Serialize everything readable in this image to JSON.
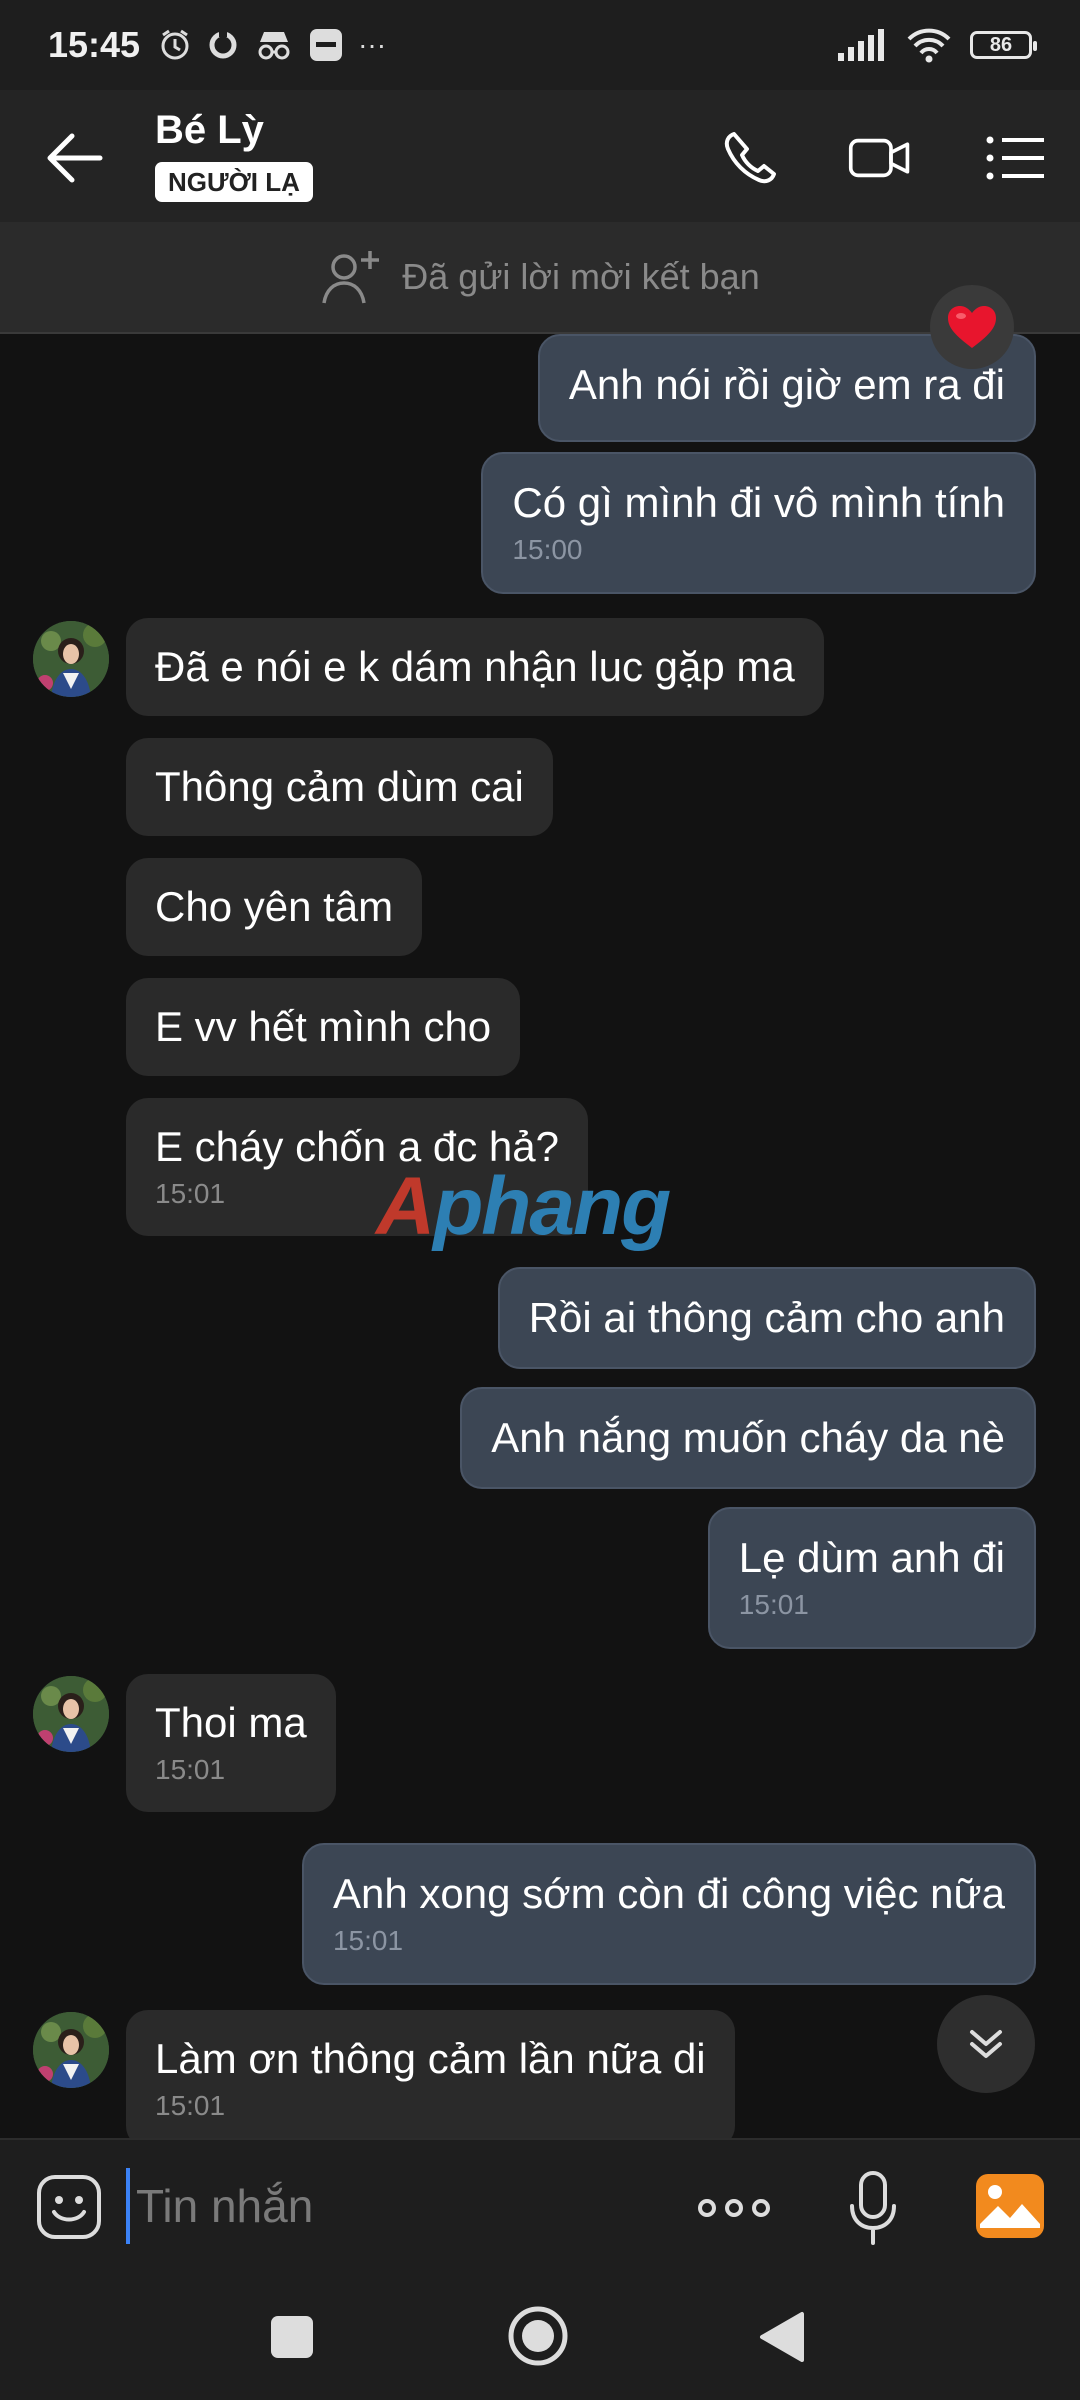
{
  "status_bar": {
    "time": "15:45",
    "battery": "86",
    "more": "···"
  },
  "header": {
    "contact_name": "Bé Lỳ",
    "badge": "NGƯỜI LẠ"
  },
  "friend_request": {
    "text": "Đã gửi lời mời kết bạn"
  },
  "messages": [
    {
      "dir": "out",
      "text": "Anh nói rồi giờ em ra đi",
      "time": ""
    },
    {
      "dir": "out",
      "text": "Có gì mình đi vô mình tính",
      "time": "15:00"
    },
    {
      "dir": "in",
      "text": "Đã e nói e k dám nhận luc gặp ma",
      "time": ""
    },
    {
      "dir": "in",
      "text": "Thông cảm dùm cai",
      "time": ""
    },
    {
      "dir": "in",
      "text": "Cho yên tâm",
      "time": ""
    },
    {
      "dir": "in",
      "text": "E vv hết mình cho",
      "time": ""
    },
    {
      "dir": "in",
      "text": "E cháy chốn a đc hả?",
      "time": "15:01"
    },
    {
      "dir": "out",
      "text": "Rồi ai thông cảm cho anh",
      "time": ""
    },
    {
      "dir": "out",
      "text": "Anh nắng muốn cháy da nè",
      "time": ""
    },
    {
      "dir": "out",
      "text": "Lẹ dùm anh đi",
      "time": "15:01"
    },
    {
      "dir": "in",
      "text": "Thoi ma",
      "time": "15:01"
    },
    {
      "dir": "out",
      "text": "Anh xong sớm còn đi công việc nữa",
      "time": "15:01"
    },
    {
      "dir": "in",
      "text": "Làm ơn thông cảm lần nữa di",
      "time": "15:01"
    }
  ],
  "watermark": {
    "first": "A",
    "rest": "phang"
  },
  "input": {
    "placeholder": "Tin nhắn",
    "value": ""
  },
  "colors": {
    "outgoing_bubble": "#3c4654",
    "incoming_bubble": "#2a2a2a",
    "background": "#121212",
    "accent": "#3b82f6"
  },
  "icons": [
    "back-arrow-icon",
    "phone-icon",
    "video-call-icon",
    "menu-list-icon",
    "add-friend-icon",
    "heart-icon",
    "scroll-down-icon",
    "emoji-icon",
    "more-dots-icon",
    "microphone-icon",
    "gallery-icon",
    "nav-recents-icon",
    "nav-home-icon",
    "nav-back-icon"
  ]
}
